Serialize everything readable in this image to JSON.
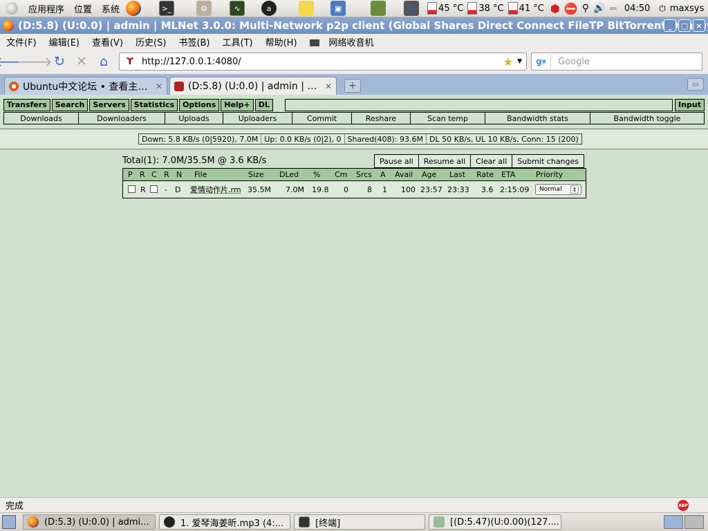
{
  "top_panel": {
    "menus": [
      "应用程序",
      "位置",
      "系统"
    ],
    "temps": [
      "45 °C",
      "38 °C",
      "41 °C"
    ],
    "time": "04:50",
    "user": "maxsys",
    "icons": [
      "firefox-icon",
      "terminal-icon",
      "installer-icon",
      "monitor-icon",
      "amarok-icon",
      "notes-icon",
      "virtualbox-icon",
      "book-icon",
      "gimp-icon"
    ]
  },
  "window": {
    "title": "(D:5.8) (U:0.0) | admin | MLNet 3.0.0: Multi-Network p2p client (Global Shares Direct Connect FileTP BitTorrent Donkey (SU"
  },
  "menubar": {
    "items": [
      "文件(F)",
      "编辑(E)",
      "查看(V)",
      "历史(S)",
      "书签(B)",
      "工具(T)",
      "帮助(H)"
    ],
    "rss_label": "网络收音机"
  },
  "navbar": {
    "url": "http://127.0.0.1:4080/",
    "search_placeholder": "Google"
  },
  "tabs": [
    {
      "label": "Ubuntu中文论坛 • 查看主题 ..."
    },
    {
      "label": "(D:5.8) (U:0.0) | admin | ML..."
    }
  ],
  "mlnet": {
    "commands": [
      "Transfers",
      "Search",
      "Servers",
      "Statistics",
      "Options",
      "Help+",
      "DL"
    ],
    "input_button": "Input",
    "subnav": [
      "Downloads",
      "Downloaders",
      "Uploads",
      "Uploaders",
      "Commit",
      "Reshare",
      "Scan temp",
      "Bandwidth stats",
      "Bandwidth toggle"
    ],
    "status": {
      "down": "Down: 5.8 KB/s (0|5920), 7.0M",
      "up": "Up: 0.0 KB/s (0|2), 0",
      "shared": "Shared(408): 93.6M",
      "limits": "DL 50 KB/s, UL 10 KB/s, Conn: 15 (200)"
    },
    "downloads": {
      "total": "Total(1): 7.0M/35.5M @ 3.6 KB/s",
      "actions": [
        "Pause all",
        "Resume all",
        "Clear all",
        "Submit changes"
      ],
      "columns": [
        "P",
        "R",
        "C",
        "R",
        "N",
        "File",
        "Size",
        "DLed",
        "%",
        "Cm",
        "Srcs",
        "A",
        "Avail",
        "Age",
        "Last",
        "Rate",
        "ETA",
        "Priority"
      ],
      "rows": [
        {
          "r_flag": "R",
          "sep": "-",
          "net": "D",
          "file": "爱情动作片.rm",
          "size": "35.5M",
          "dled": "7.0M",
          "pct": "19.8",
          "cm": "0",
          "srcs": "8",
          "a": "1",
          "avail": "100",
          "age": "23:57",
          "last": "23:33",
          "rate": "3.6",
          "eta": "2:15:09",
          "priority": "Normal"
        }
      ]
    }
  },
  "status_bar": {
    "text": "完成",
    "abp": "ABP"
  },
  "taskbar": {
    "tasks": [
      "(D:5.3) (U:0.0) | admi...",
      "1. 爱琴海姜昕.mp3 (4:...",
      "[终端]",
      "[(D:5.47)(U:0.00)(127...."
    ]
  }
}
